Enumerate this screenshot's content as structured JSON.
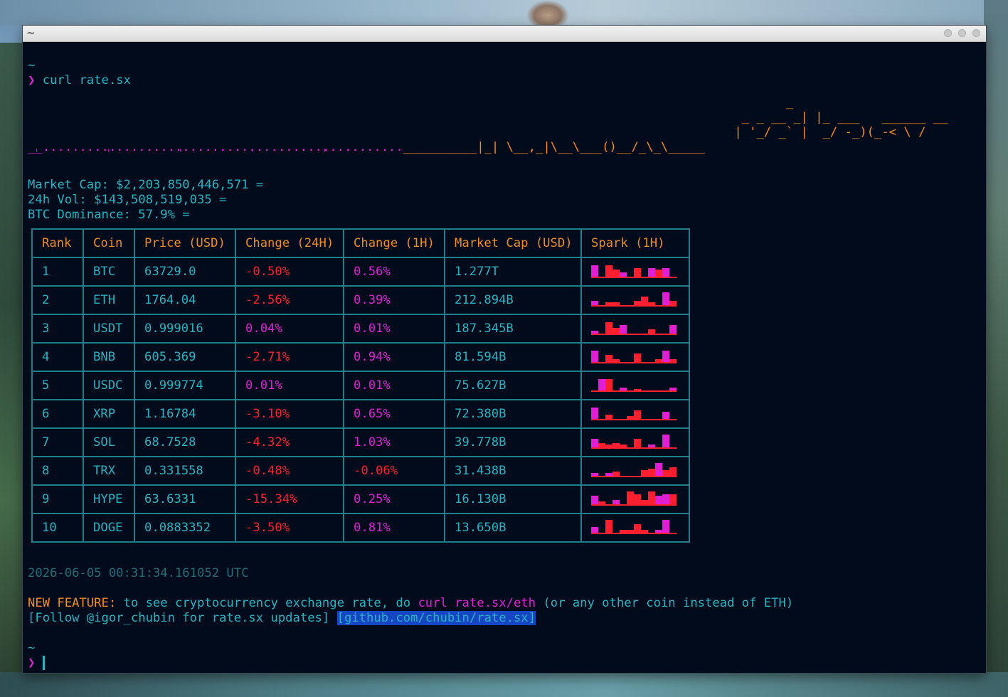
{
  "window": {
    "title": "~"
  },
  "terminal": {
    "tilde_top": "~",
    "prompt_symbol": "❯",
    "command": "curl rate.sx",
    "ascii_logo": [
      "                                                                                                       _",
      "                                                                                                 _ _ __ _| |_ ___   ______ __",
      "                                                                                                | '_/ _` |  _/ -_)(_-< \\ /",
      "__.................................................__________|_| \\__,_|\\__\\___()__/_\\_\\_____"
    ],
    "ascii_dots_line": "__.................................................",
    "ascii_tail": "__________|_| \\__,_|\\__\\___()__/_\\_\\_____",
    "ascii_ticks": " '           '           '           '           '",
    "market_cap_label": "Market Cap: $2,203,850,446,571 =",
    "volume_label": "24h Vol: $143,508,519,035 =",
    "dominance_label": "BTC Dominance: 57.9% =",
    "table": {
      "headers": [
        "Rank",
        "Coin",
        "Price (USD)",
        "Change (24H)",
        "Change (1H)",
        "Market Cap (USD)",
        "Spark (1H)"
      ],
      "rows": [
        {
          "rank": "1",
          "coin": "BTC",
          "price": "63729.0",
          "ch24": "-0.50%",
          "ch1": "0.56%",
          "cap": "1.277T"
        },
        {
          "rank": "2",
          "coin": "ETH",
          "price": "1764.04",
          "ch24": "-2.56%",
          "ch1": "0.39%",
          "cap": "212.894B"
        },
        {
          "rank": "3",
          "coin": "USDT",
          "price": "0.999016",
          "ch24": "0.04%",
          "ch1": "0.01%",
          "cap": "187.345B"
        },
        {
          "rank": "4",
          "coin": "BNB",
          "price": "605.369",
          "ch24": "-2.71%",
          "ch1": "0.94%",
          "cap": "81.594B"
        },
        {
          "rank": "5",
          "coin": "USDC",
          "price": "0.999774",
          "ch24": "0.01%",
          "ch1": "0.01%",
          "cap": "75.627B"
        },
        {
          "rank": "6",
          "coin": "XRP",
          "price": "1.16784",
          "ch24": "-3.10%",
          "ch1": "0.65%",
          "cap": "72.380B"
        },
        {
          "rank": "7",
          "coin": "SOL",
          "price": "68.7528",
          "ch24": "-4.32%",
          "ch1": "1.03%",
          "cap": "39.778B"
        },
        {
          "rank": "8",
          "coin": "TRX",
          "price": "0.331558",
          "ch24": "-0.48%",
          "ch1": "-0.06%",
          "cap": "31.438B"
        },
        {
          "rank": "9",
          "coin": "HYPE",
          "price": "63.6331",
          "ch24": "-15.34%",
          "ch1": "0.25%",
          "cap": "16.130B"
        },
        {
          "rank": "10",
          "coin": "DOGE",
          "price": "0.0883352",
          "ch24": "-3.50%",
          "ch1": "0.81%",
          "cap": "13.650B"
        }
      ]
    },
    "timestamp": "2026-06-05 00:31:34.161052 UTC",
    "new_feature_label": "NEW FEATURE:",
    "new_feature_text1": " to see cryptocurrency exchange rate, do ",
    "new_feature_cmd": "curl rate.sx/eth",
    "new_feature_text2": " (or any other coin instead of ETH)",
    "follow_text": "[Follow @igor_chubin for rate.sx updates] ",
    "github_link": "[github.com/chubin/rate.sx]",
    "tilde_bottom": "~",
    "colors": {
      "background": "#010b1c",
      "cyan": "#26b4c2",
      "orange": "#f28c1f",
      "magenta": "#e01fd5",
      "red": "#ff1f2f",
      "link_bg": "#1746c4"
    }
  }
}
